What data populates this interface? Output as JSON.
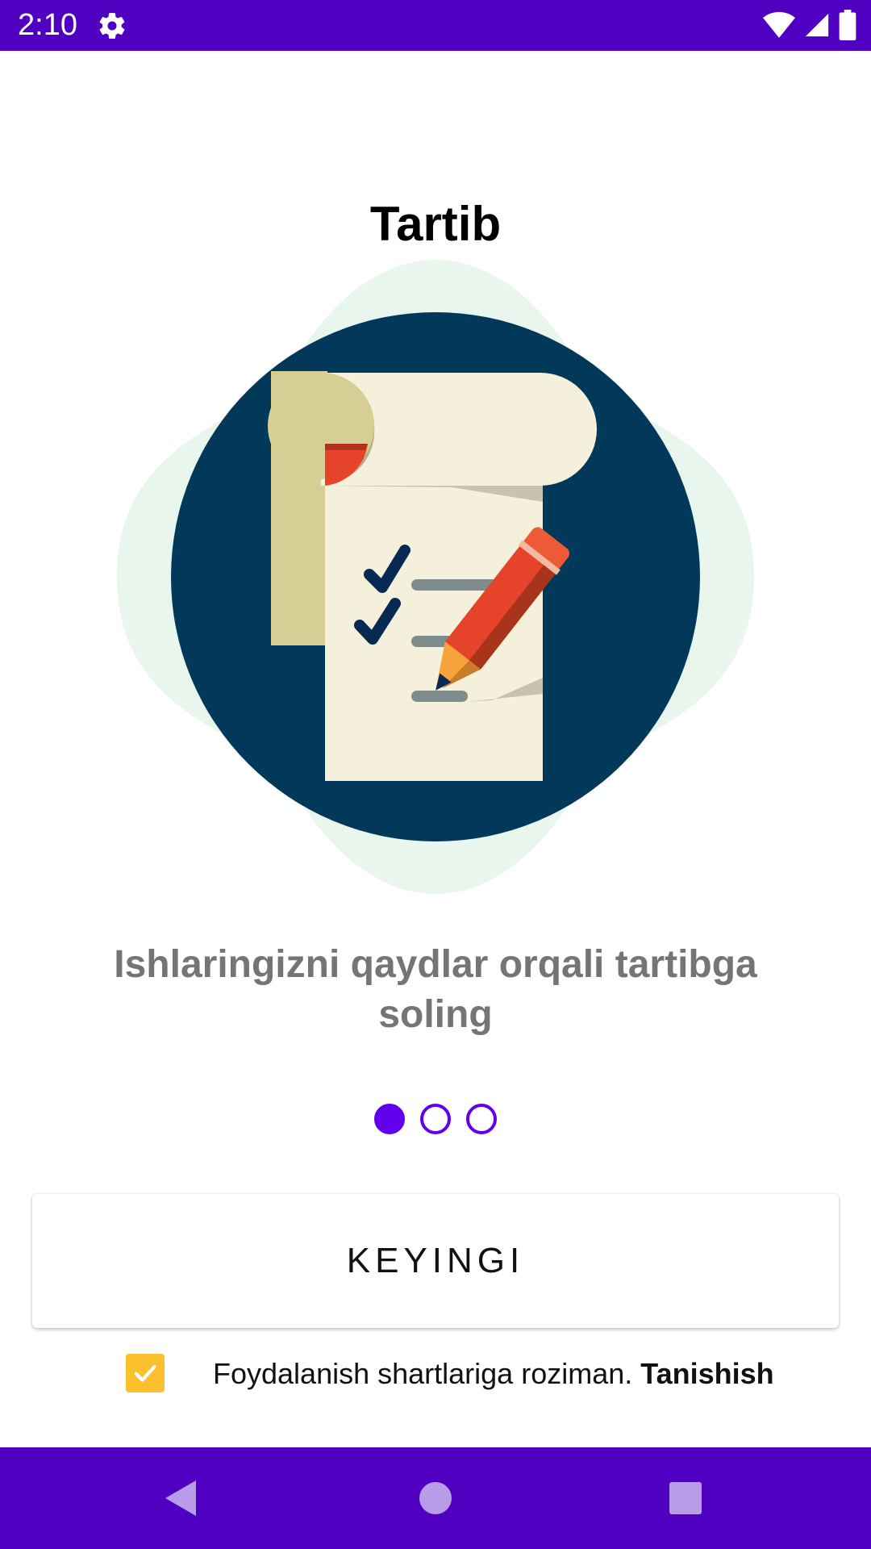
{
  "status_bar": {
    "time": "2:10",
    "icons": [
      "gear-icon",
      "wifi-icon",
      "signal-icon",
      "battery-icon"
    ],
    "background": "#5000c0"
  },
  "onboarding": {
    "title": "Tartib",
    "illustration_icon": "checklist-scroll-pencil-icon",
    "subtitle": "Ishlaringizni qaydlar orqali tartibga soling",
    "pager": {
      "total": 3,
      "current": 1
    },
    "next_button_label": "KEYINGI"
  },
  "terms": {
    "checked": true,
    "text": "Foydalanish shartlariga roziman.",
    "link_label": "Tanishish"
  },
  "nav_bar": {
    "icons": [
      "back-icon",
      "home-icon",
      "recents-icon"
    ]
  },
  "colors": {
    "accent": "#6200ee",
    "checkbox": "#fbc02d",
    "illustration_circle": "#02385a",
    "blob": "#e8f6ee"
  }
}
